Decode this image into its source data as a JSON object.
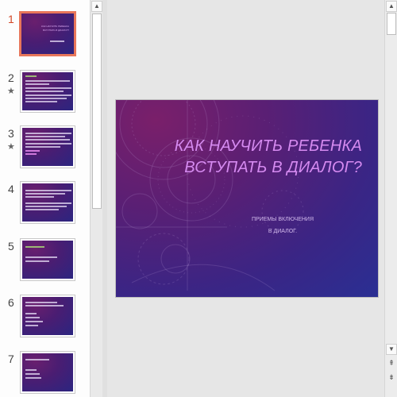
{
  "thumbnails": [
    {
      "number": "1",
      "star": "",
      "active": true,
      "text": [
        "КАК НАУЧИТЬ РЕБЕНКА",
        "ВСТУПАТЬ В ДИАЛОГ?"
      ]
    },
    {
      "number": "2",
      "star": "★",
      "active": false,
      "text": [
        "Цель игры",
        "Упражнения на развитие диалогической речи",
        "детей...",
        "Цель: развивать умение слушать и",
        "отвечать на вопросы в диалоге"
      ]
    },
    {
      "number": "3",
      "star": "★",
      "active": false,
      "text": [
        "Упражнения на развитие умения",
        "задавать вопросы и отвечать",
        "на вопросы собеседника",
        "Игра 1",
        "Игра 2"
      ]
    },
    {
      "number": "4",
      "star": "",
      "active": false,
      "text": [
        "Упражнения на развитие умения",
        "поддерживать беседу",
        "Следующий этап: развитие",
        "речевого взаимодействия"
      ]
    },
    {
      "number": "5",
      "star": "",
      "active": false,
      "text": [
        "ДИАЛОГ В ИГРЕ",
        "Игра: Магазин",
        "Игра: Телефон"
      ]
    },
    {
      "number": "6",
      "star": "",
      "active": false,
      "text": [
        "ПРИЕМЫ РАБОТЫ С РЕБЕНКОМ",
        "Беседа",
        "Вопросы",
        "Рассказ"
      ]
    },
    {
      "number": "7",
      "star": "",
      "active": false,
      "text": [
        "СЛОВАРЬ ДИАЛОГА",
        "Вопросы",
        "Ответы"
      ]
    }
  ],
  "slide": {
    "title_line1": "КАК НАУЧИТЬ РЕБЕНКА",
    "title_line2": "ВСТУПАТЬ В ДИАЛОГ?",
    "subtitle_line1": "ПРИЕМЫ ВКЛЮЧЕНИЯ",
    "subtitle_line2": "В ДИАЛОГ."
  },
  "icons": {
    "scroll_up": "▲",
    "scroll_down": "▼",
    "prev_slide": "⇞",
    "next_slide": "⇟"
  },
  "colors": {
    "active_thumb_border": "#e8765a",
    "active_number": "#d24726",
    "title": "#d58af0"
  }
}
